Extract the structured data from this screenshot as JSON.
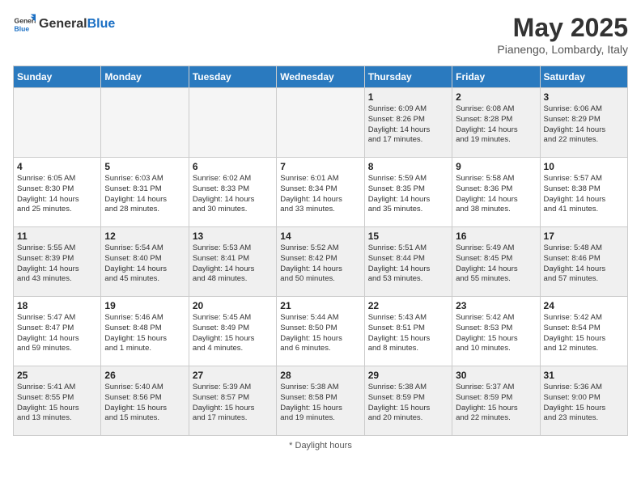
{
  "header": {
    "logo_general": "General",
    "logo_blue": "Blue",
    "month": "May 2025",
    "location": "Pianengo, Lombardy, Italy"
  },
  "days_of_week": [
    "Sunday",
    "Monday",
    "Tuesday",
    "Wednesday",
    "Thursday",
    "Friday",
    "Saturday"
  ],
  "footer": {
    "daylight_note": "Daylight hours"
  },
  "weeks": [
    [
      {
        "day": "",
        "info": "",
        "empty": true
      },
      {
        "day": "",
        "info": "",
        "empty": true
      },
      {
        "day": "",
        "info": "",
        "empty": true
      },
      {
        "day": "",
        "info": "",
        "empty": true
      },
      {
        "day": "1",
        "info": "Sunrise: 6:09 AM\nSunset: 8:26 PM\nDaylight: 14 hours\nand 17 minutes."
      },
      {
        "day": "2",
        "info": "Sunrise: 6:08 AM\nSunset: 8:28 PM\nDaylight: 14 hours\nand 19 minutes."
      },
      {
        "day": "3",
        "info": "Sunrise: 6:06 AM\nSunset: 8:29 PM\nDaylight: 14 hours\nand 22 minutes."
      }
    ],
    [
      {
        "day": "4",
        "info": "Sunrise: 6:05 AM\nSunset: 8:30 PM\nDaylight: 14 hours\nand 25 minutes."
      },
      {
        "day": "5",
        "info": "Sunrise: 6:03 AM\nSunset: 8:31 PM\nDaylight: 14 hours\nand 28 minutes."
      },
      {
        "day": "6",
        "info": "Sunrise: 6:02 AM\nSunset: 8:33 PM\nDaylight: 14 hours\nand 30 minutes."
      },
      {
        "day": "7",
        "info": "Sunrise: 6:01 AM\nSunset: 8:34 PM\nDaylight: 14 hours\nand 33 minutes."
      },
      {
        "day": "8",
        "info": "Sunrise: 5:59 AM\nSunset: 8:35 PM\nDaylight: 14 hours\nand 35 minutes."
      },
      {
        "day": "9",
        "info": "Sunrise: 5:58 AM\nSunset: 8:36 PM\nDaylight: 14 hours\nand 38 minutes."
      },
      {
        "day": "10",
        "info": "Sunrise: 5:57 AM\nSunset: 8:38 PM\nDaylight: 14 hours\nand 41 minutes."
      }
    ],
    [
      {
        "day": "11",
        "info": "Sunrise: 5:55 AM\nSunset: 8:39 PM\nDaylight: 14 hours\nand 43 minutes."
      },
      {
        "day": "12",
        "info": "Sunrise: 5:54 AM\nSunset: 8:40 PM\nDaylight: 14 hours\nand 45 minutes."
      },
      {
        "day": "13",
        "info": "Sunrise: 5:53 AM\nSunset: 8:41 PM\nDaylight: 14 hours\nand 48 minutes."
      },
      {
        "day": "14",
        "info": "Sunrise: 5:52 AM\nSunset: 8:42 PM\nDaylight: 14 hours\nand 50 minutes."
      },
      {
        "day": "15",
        "info": "Sunrise: 5:51 AM\nSunset: 8:44 PM\nDaylight: 14 hours\nand 53 minutes."
      },
      {
        "day": "16",
        "info": "Sunrise: 5:49 AM\nSunset: 8:45 PM\nDaylight: 14 hours\nand 55 minutes."
      },
      {
        "day": "17",
        "info": "Sunrise: 5:48 AM\nSunset: 8:46 PM\nDaylight: 14 hours\nand 57 minutes."
      }
    ],
    [
      {
        "day": "18",
        "info": "Sunrise: 5:47 AM\nSunset: 8:47 PM\nDaylight: 14 hours\nand 59 minutes."
      },
      {
        "day": "19",
        "info": "Sunrise: 5:46 AM\nSunset: 8:48 PM\nDaylight: 15 hours\nand 1 minute."
      },
      {
        "day": "20",
        "info": "Sunrise: 5:45 AM\nSunset: 8:49 PM\nDaylight: 15 hours\nand 4 minutes."
      },
      {
        "day": "21",
        "info": "Sunrise: 5:44 AM\nSunset: 8:50 PM\nDaylight: 15 hours\nand 6 minutes."
      },
      {
        "day": "22",
        "info": "Sunrise: 5:43 AM\nSunset: 8:51 PM\nDaylight: 15 hours\nand 8 minutes."
      },
      {
        "day": "23",
        "info": "Sunrise: 5:42 AM\nSunset: 8:53 PM\nDaylight: 15 hours\nand 10 minutes."
      },
      {
        "day": "24",
        "info": "Sunrise: 5:42 AM\nSunset: 8:54 PM\nDaylight: 15 hours\nand 12 minutes."
      }
    ],
    [
      {
        "day": "25",
        "info": "Sunrise: 5:41 AM\nSunset: 8:55 PM\nDaylight: 15 hours\nand 13 minutes."
      },
      {
        "day": "26",
        "info": "Sunrise: 5:40 AM\nSunset: 8:56 PM\nDaylight: 15 hours\nand 15 minutes."
      },
      {
        "day": "27",
        "info": "Sunrise: 5:39 AM\nSunset: 8:57 PM\nDaylight: 15 hours\nand 17 minutes."
      },
      {
        "day": "28",
        "info": "Sunrise: 5:38 AM\nSunset: 8:58 PM\nDaylight: 15 hours\nand 19 minutes."
      },
      {
        "day": "29",
        "info": "Sunrise: 5:38 AM\nSunset: 8:59 PM\nDaylight: 15 hours\nand 20 minutes."
      },
      {
        "day": "30",
        "info": "Sunrise: 5:37 AM\nSunset: 8:59 PM\nDaylight: 15 hours\nand 22 minutes."
      },
      {
        "day": "31",
        "info": "Sunrise: 5:36 AM\nSunset: 9:00 PM\nDaylight: 15 hours\nand 23 minutes."
      }
    ]
  ]
}
